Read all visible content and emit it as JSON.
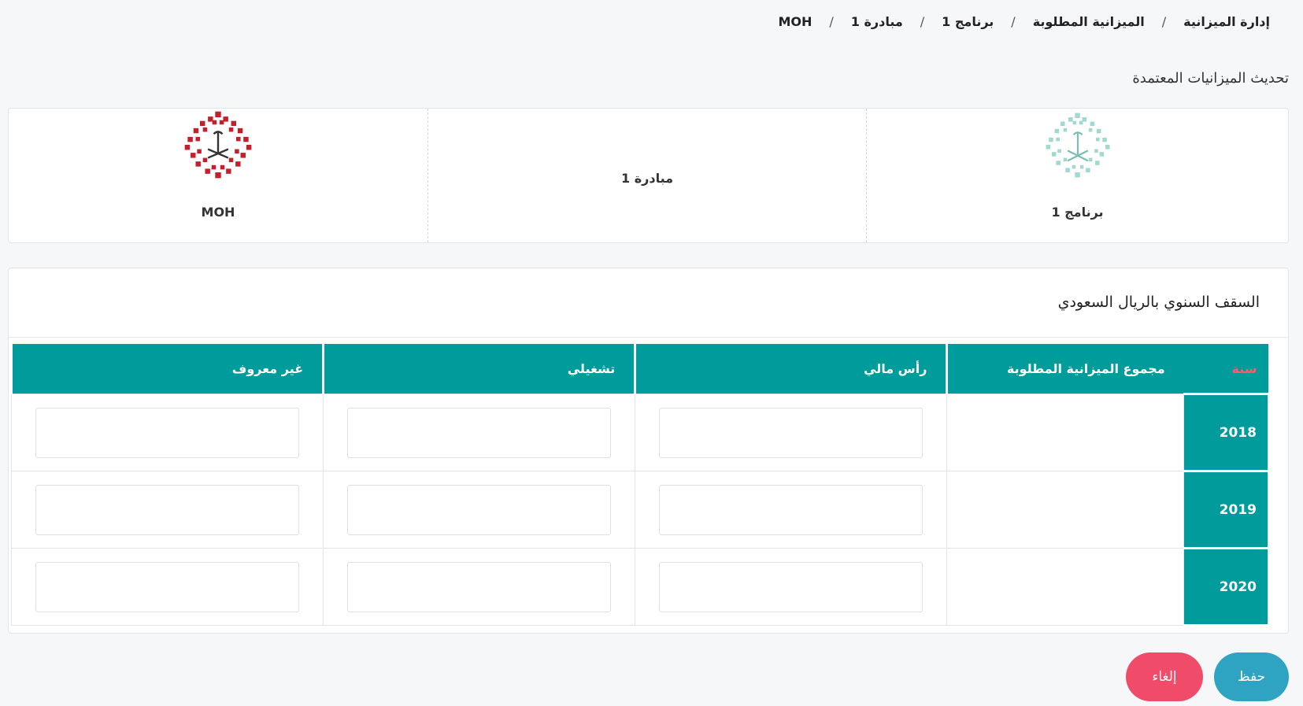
{
  "breadcrumb": {
    "items": [
      "إدارة الميزانية",
      "الميزانية المطلوبة",
      "برنامج 1",
      "مبادرة 1",
      "MOH"
    ],
    "separator": "/"
  },
  "page": {
    "title": "تحديث الميزانيات المعتمدة"
  },
  "info_card": {
    "program": "برنامج 1",
    "initiative": "مبادرة 1",
    "entity": "MOH",
    "colors": {
      "program_logo": "#9fd9cf",
      "entity_logo": "#c4202b"
    },
    "icons": {
      "program_logo": "vision-emblem-icon",
      "entity_logo": "vision-emblem-icon"
    }
  },
  "budget": {
    "heading": "السقف السنوي بالريال السعودي",
    "columns": {
      "year": "سنة",
      "total": "مجموع الميزانية المطلوبة",
      "capital": "رأس مالي",
      "operational": "تشغيلي",
      "unknown": "غير معروف"
    },
    "rows": [
      {
        "year": "2018",
        "total": "",
        "capital": "",
        "operational": "",
        "unknown": ""
      },
      {
        "year": "2019",
        "total": "",
        "capital": "",
        "operational": "",
        "unknown": ""
      },
      {
        "year": "2020",
        "total": "",
        "capital": "",
        "operational": "",
        "unknown": ""
      }
    ]
  },
  "actions": {
    "save": "حفظ",
    "cancel": "إلغاء"
  },
  "colors": {
    "table_header": "#009b9b",
    "year_header_text": "#ff5b6e",
    "save_button": "#2fa3c2",
    "cancel_button": "#f04c6a"
  }
}
